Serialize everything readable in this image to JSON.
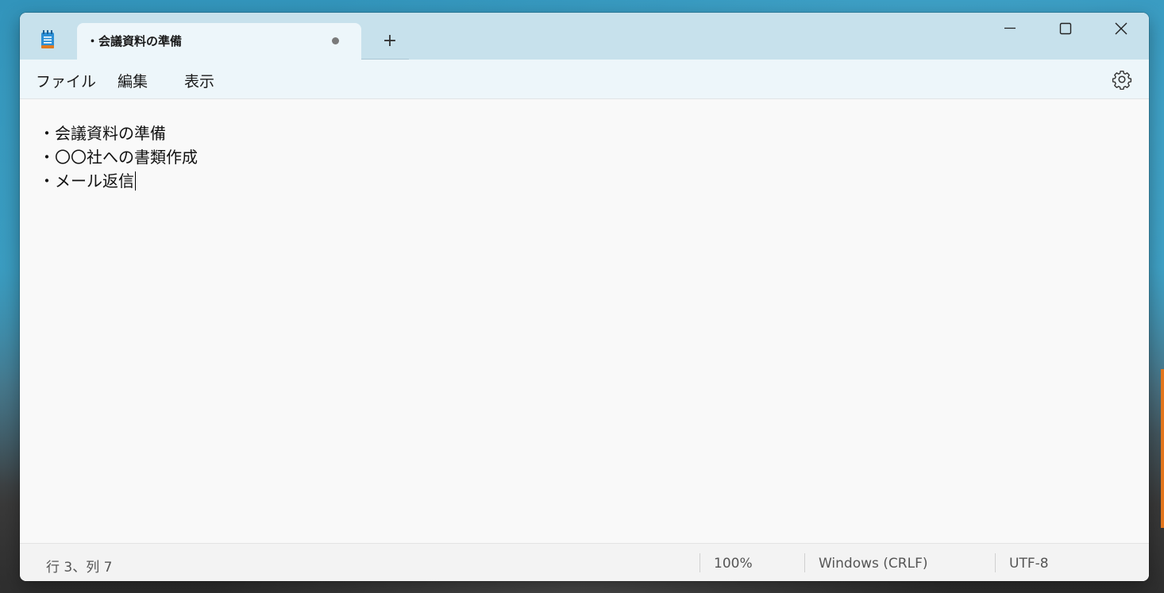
{
  "window": {
    "tab_title": "・会議資料の準備",
    "new_tab_label": "+"
  },
  "menu": {
    "file": "ファイル",
    "edit": "編集",
    "view": "表示"
  },
  "editor": {
    "lines": [
      "・会議資料の準備",
      "・〇〇社への書類作成",
      "・メール返信"
    ]
  },
  "status": {
    "position": "行 3、列 7",
    "zoom": "100%",
    "line_ending": "Windows (CRLF)",
    "encoding": "UTF-8"
  },
  "colors": {
    "titlebar": "#c7e1ec",
    "menubar": "#edf6fa",
    "editor_bg": "#f9f9f9",
    "app_icon": "#2b8fd6"
  },
  "icons": {
    "app": "notepad-icon",
    "minimize": "minimize-icon",
    "maximize": "maximize-icon",
    "close": "close-icon",
    "settings": "gear-icon",
    "unsaved": "unsaved-dot-icon"
  }
}
